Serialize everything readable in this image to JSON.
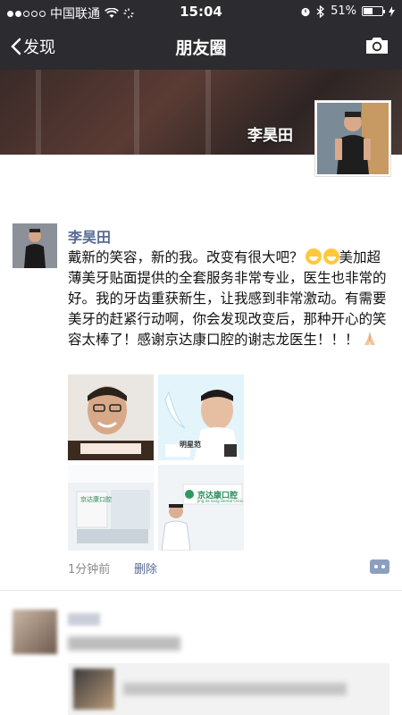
{
  "status_bar": {
    "carrier": "中国联通",
    "time": "15:04",
    "battery": "51%",
    "battery_level": 0.51
  },
  "nav": {
    "back_label": "发现",
    "title": "朋友圈"
  },
  "profile": {
    "name": "李昊田"
  },
  "post": {
    "author": "李昊田",
    "text_1": "戴新的笑容，新的我。改变有很大吧？",
    "text_2": "美加超薄美牙贴面提供的全套服务非常专业，医生也非常的好。我的牙齿重获新生，让我感到非常激动。有需要美牙的赶紧行动啊，你会发现改变后，那种开心的笑容太棒了！感谢京达康口腔的谢志龙医生！！！",
    "photos": [
      "photo-1",
      "photo-2",
      "photo-3",
      "photo-4"
    ],
    "photo_captions": {
      "p2_label": "明星范",
      "p4_sign": "京达康口腔",
      "p4_sign_en": "Jing da kang Dental Clinic",
      "p3_sign": "京达康口腔"
    },
    "timestamp": "1分钟前",
    "delete_label": "删除"
  },
  "colors": {
    "link_blue": "#576b95",
    "nav_bg": "#2b2b30"
  }
}
